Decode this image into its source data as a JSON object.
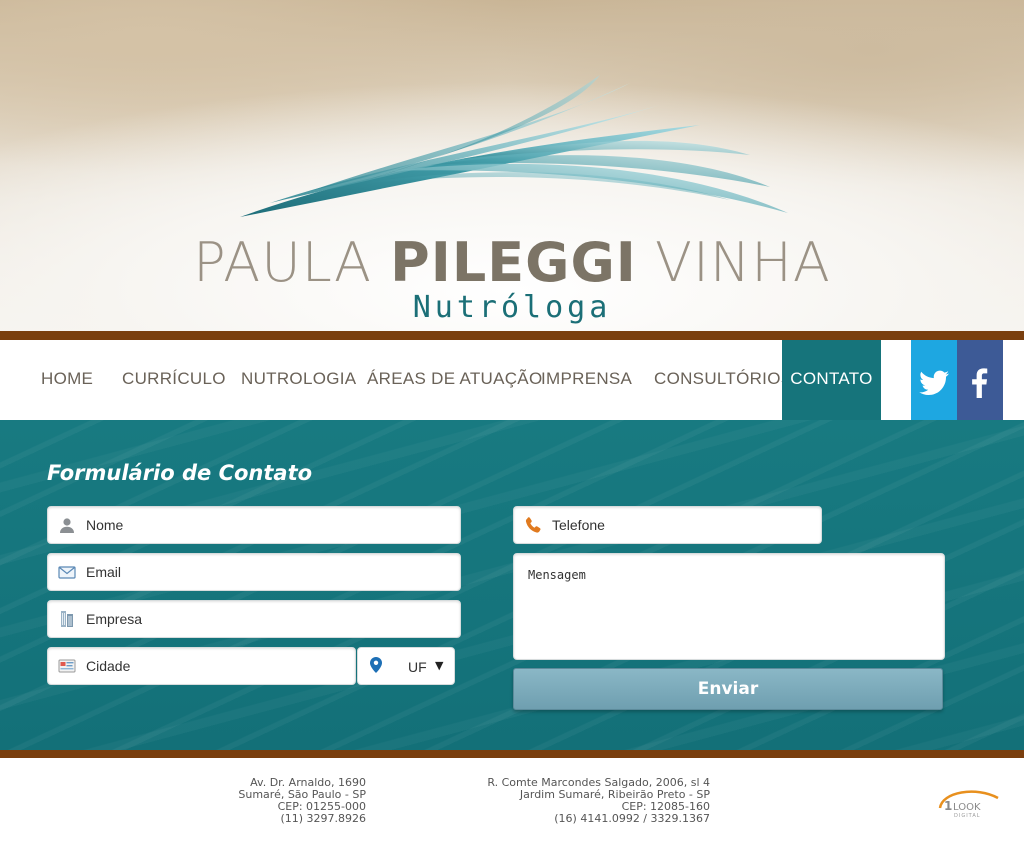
{
  "brand": {
    "name_first": "PAULA",
    "name_middle": "PILEGGI",
    "name_last": "VINHA",
    "subtitle": "Nutróloga"
  },
  "nav": {
    "items": [
      {
        "label": "HOME"
      },
      {
        "label": "CURRÍCULO"
      },
      {
        "label": "NUTROLOGIA"
      },
      {
        "label": "ÁREAS DE ATUAÇÃO"
      },
      {
        "label": "IMPRENSA"
      },
      {
        "label": "CONSULTÓRIOS"
      },
      {
        "label": "CONTATO",
        "active": true
      }
    ],
    "social": [
      {
        "name": "twitter",
        "icon": "twitter-icon",
        "color": "#1ea7e1"
      },
      {
        "name": "facebook",
        "icon": "facebook-icon",
        "color": "#3d5a96"
      }
    ]
  },
  "form": {
    "title": "Formulário de Contato",
    "fields": {
      "nome": {
        "placeholder": "Nome",
        "icon": "user-icon"
      },
      "email": {
        "placeholder": "Email",
        "icon": "envelope-icon"
      },
      "empresa": {
        "placeholder": "Empresa",
        "icon": "building-icon"
      },
      "cidade": {
        "placeholder": "Cidade",
        "icon": "map-card-icon"
      },
      "uf": {
        "selected": "UF",
        "icon": "location-pin-icon"
      },
      "telefone": {
        "placeholder": "Telefone",
        "icon": "phone-icon"
      },
      "mensagem": {
        "placeholder": "Mensagem"
      }
    },
    "submit_label": "Enviar"
  },
  "footer": {
    "address_1": [
      "Av. Dr. Arnaldo, 1690",
      "Sumaré, São Paulo - SP",
      "CEP: 01255-000",
      "(11) 3297.8926"
    ],
    "address_2": [
      "R. Comte Marcondes Salgado, 2006, sl 4",
      "Jardim Sumaré, Ribeirão Preto - SP",
      "CEP: 12085-160",
      "(16) 4141.0992 / 3329.1367"
    ],
    "agency_logo": {
      "text_main": "1LOOK",
      "text_sub": "DIGITAL"
    }
  },
  "colors": {
    "teal": "#16747b",
    "brown_bar": "#7a3f0e",
    "twitter": "#1ea7e1",
    "facebook": "#3d5a96",
    "button": "#7eaebd"
  }
}
